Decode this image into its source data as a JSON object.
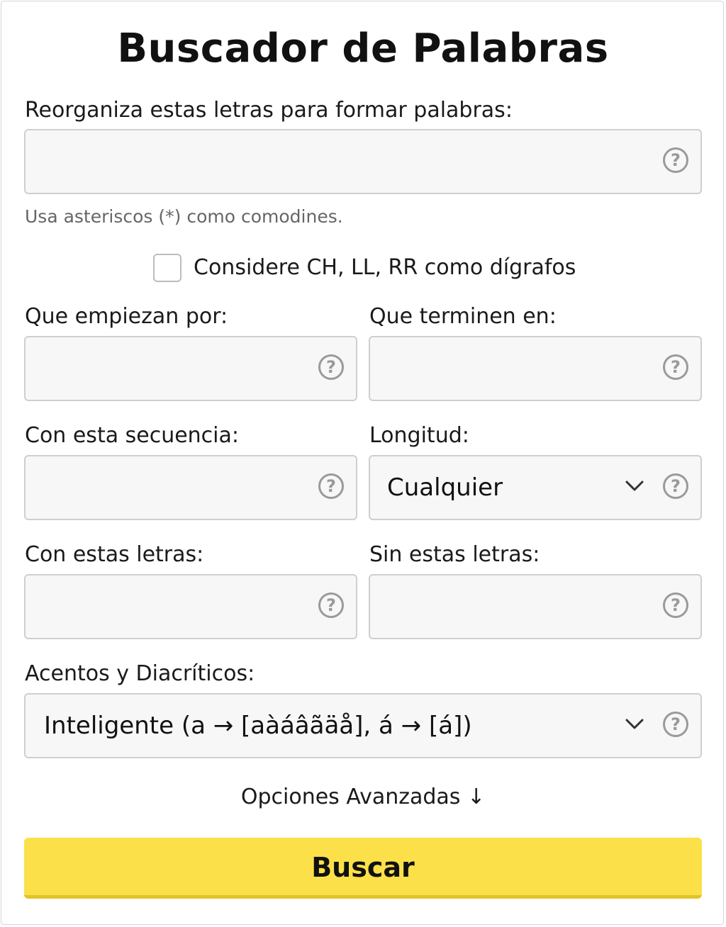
{
  "title": "Buscador de Palabras",
  "rearrange": {
    "label": "Reorganiza estas letras para formar palabras:",
    "value": "",
    "hint": "Usa asteriscos (*) como comodines."
  },
  "digraphs": {
    "label": "Considere CH, LL, RR como dígrafos",
    "checked": false
  },
  "starts_with": {
    "label": "Que empiezan por:",
    "value": ""
  },
  "ends_with": {
    "label": "Que terminen en:",
    "value": ""
  },
  "sequence": {
    "label": "Con esta secuencia:",
    "value": ""
  },
  "length": {
    "label": "Longitud:",
    "selected": "Cualquier"
  },
  "with_letters": {
    "label": "Con estas letras:",
    "value": ""
  },
  "without_letters": {
    "label": "Sin estas letras:",
    "value": ""
  },
  "accents": {
    "label": "Acentos y Diacríticos:",
    "selected": "Inteligente (a → [aàáâãäå], á → [á])"
  },
  "help_glyph": "?",
  "advanced_label": "Opciones Avanzadas ↓",
  "search_button": "Buscar",
  "colors": {
    "button_bg": "#fbe04a",
    "field_bg": "#f7f7f7",
    "field_border": "#cfcfcf",
    "hint_text": "#666666"
  },
  "icons": {
    "help": "help-circle-icon",
    "dropdown": "chevron-down-icon"
  }
}
